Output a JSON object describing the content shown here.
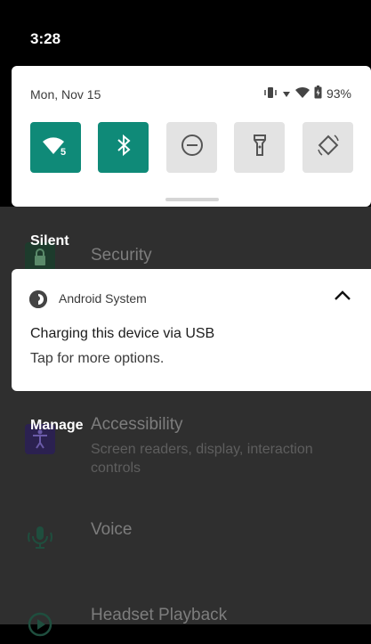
{
  "status_bar": {
    "time": "3:28"
  },
  "quick_settings": {
    "date": "Mon, Nov 15",
    "battery": "93%",
    "tiles": [
      {
        "name": "wifi",
        "icon": "wifi-icon",
        "badge": "5",
        "active": true
      },
      {
        "name": "bluetooth",
        "icon": "bluetooth-icon",
        "active": true
      },
      {
        "name": "do-not-disturb",
        "icon": "do-not-disturb-icon",
        "active": false
      },
      {
        "name": "flashlight",
        "icon": "flashlight-icon",
        "active": false
      },
      {
        "name": "auto-rotate",
        "icon": "auto-rotate-icon",
        "active": false
      }
    ]
  },
  "sections": {
    "silent": "Silent",
    "manage": "Manage"
  },
  "notification": {
    "app": "Android System",
    "title": "Charging this device via USB",
    "text": "Tap for more options."
  },
  "background_settings": {
    "items": [
      {
        "title": "Security",
        "subtitle": ""
      },
      {
        "title": "Accessibility",
        "subtitle": "Screen readers, display, interaction controls"
      },
      {
        "title": "Voice",
        "subtitle": ""
      },
      {
        "title": "Headset Playback",
        "subtitle": ""
      }
    ]
  },
  "colors": {
    "accent": "#0f8a78",
    "tile_off": "#e3e3e3",
    "scrim": "#2f2f2f"
  }
}
